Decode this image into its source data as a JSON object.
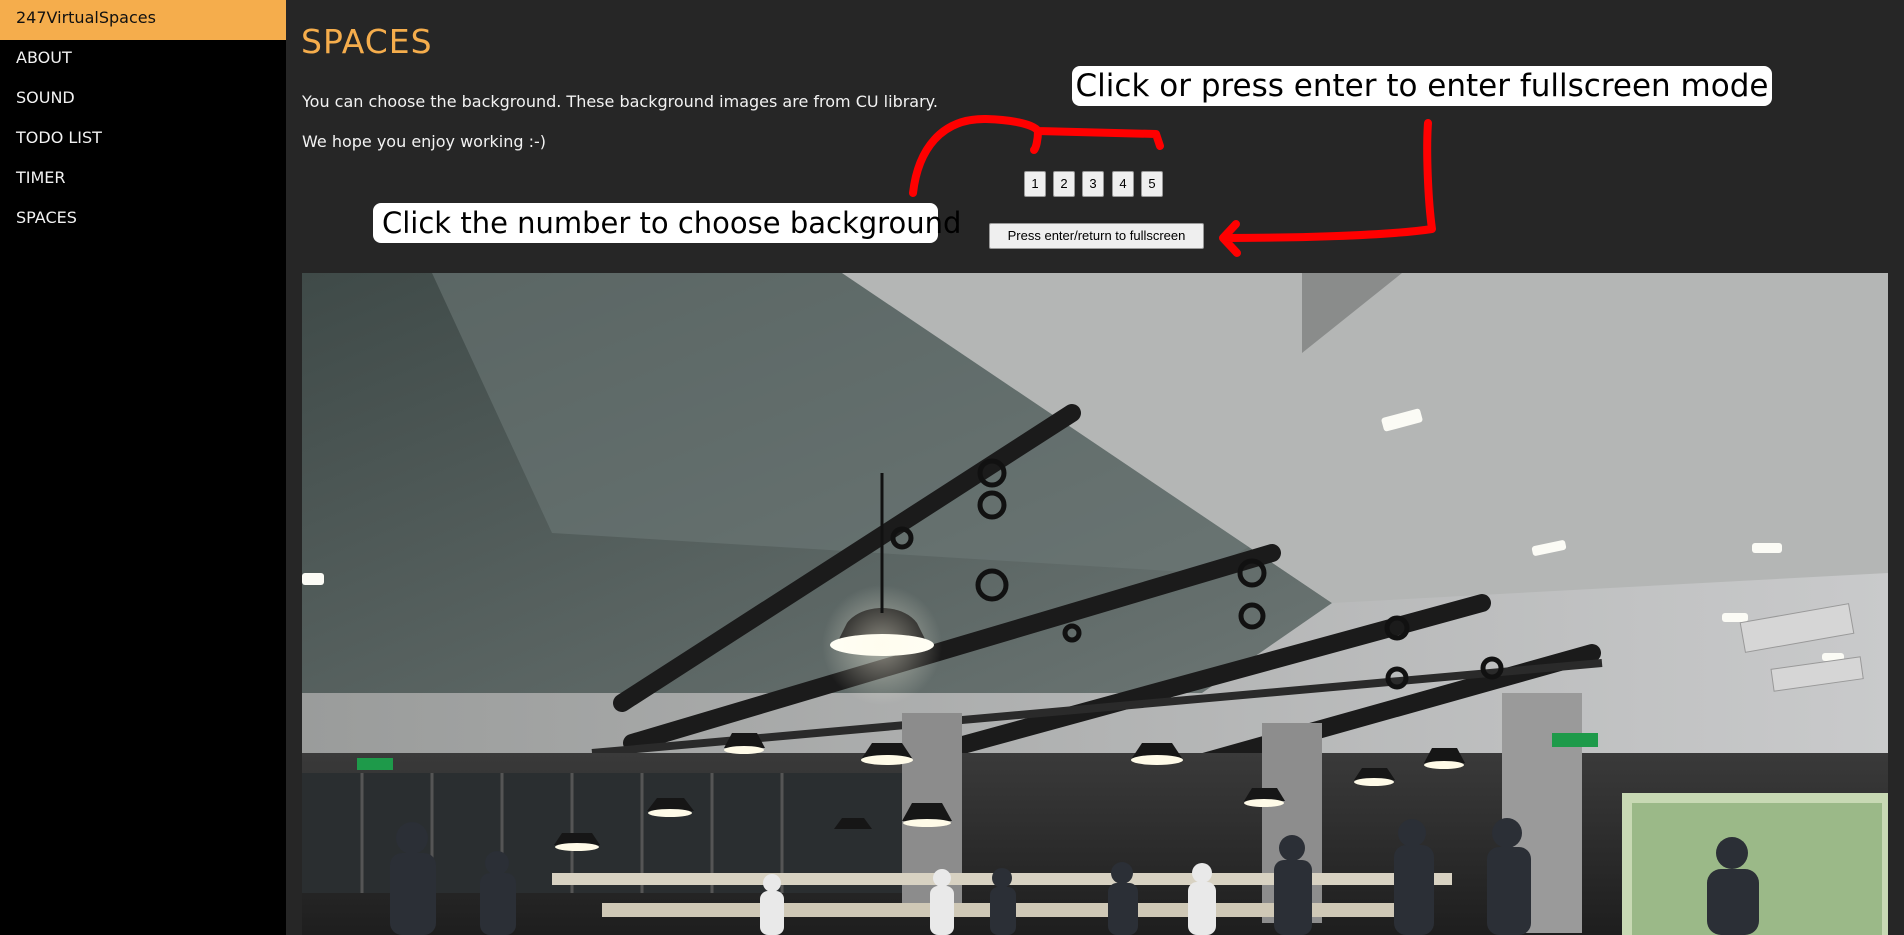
{
  "sidebar": {
    "items": [
      {
        "label": "247VirtualSpaces",
        "active": true
      },
      {
        "label": "ABOUT"
      },
      {
        "label": "SOUND"
      },
      {
        "label": "TODO LIST"
      },
      {
        "label": "TIMER"
      },
      {
        "label": "SPACES"
      }
    ]
  },
  "main": {
    "title": "SPACES",
    "intro": [
      "You can choose the background. These background images are from CU library.",
      "We hope you enjoy working :-)"
    ],
    "background_buttons": [
      "1",
      "2",
      "3",
      "4",
      "5"
    ],
    "fullscreen_button": "Press enter/return to fullscreen"
  },
  "annotations": {
    "fullscreen_hint": "Click or press enter to enter fullscreen mode",
    "background_hint": "Click the number to choose background"
  },
  "colors": {
    "accent": "#f5ad4c",
    "sidebar_bg": "#000000",
    "main_bg": "#262626",
    "annotation_arrow": "#ff0000"
  }
}
